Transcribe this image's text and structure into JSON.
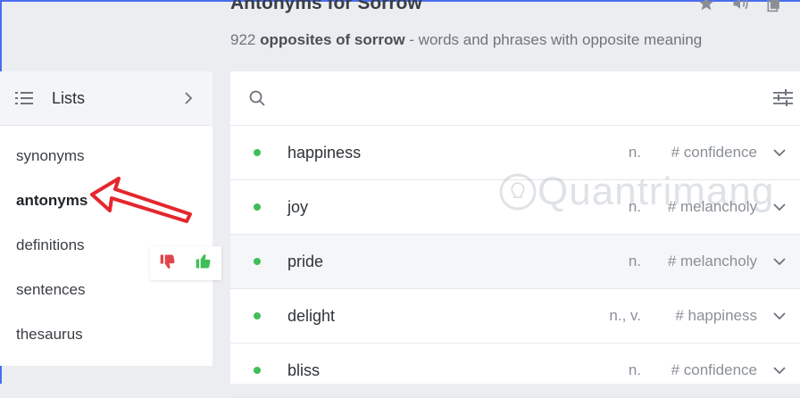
{
  "header": {
    "title": "Antonyms for Sorrow",
    "subtitle_count": "922",
    "subtitle_bold": "opposites of sorrow",
    "subtitle_rest": " - words and phrases with opposite meaning",
    "icons": [
      "star-icon",
      "speaker-icon",
      "copy-icon"
    ]
  },
  "lists_panel": {
    "title": "Lists",
    "items": [
      {
        "label": "synonyms",
        "active": false
      },
      {
        "label": "antonyms",
        "active": true
      },
      {
        "label": "definitions",
        "active": false
      },
      {
        "label": "sentences",
        "active": false
      },
      {
        "label": "thesaurus",
        "active": false
      }
    ]
  },
  "vote": {
    "down_icon": "thumbs-down-icon",
    "up_icon": "thumbs-up-icon",
    "down_color": "#e0474c",
    "up_color": "#3fbf57"
  },
  "search": {
    "placeholder": "",
    "icon": "search-icon",
    "filter_icon": "filter-sliders-icon"
  },
  "words": [
    {
      "word": "happiness",
      "pos": "n.",
      "tag": "# confidence"
    },
    {
      "word": "joy",
      "pos": "n.",
      "tag": "# melancholy"
    },
    {
      "word": "pride",
      "pos": "n.",
      "tag": "# melancholy"
    },
    {
      "word": "delight",
      "pos": "n., v.",
      "tag": "# happiness"
    },
    {
      "word": "bliss",
      "pos": "n.",
      "tag": "# confidence"
    }
  ],
  "watermark": "Quantrimang",
  "colors": {
    "accent": "#4a6cf0",
    "dot": "#3fbf57",
    "arrow": "#e5262d"
  }
}
